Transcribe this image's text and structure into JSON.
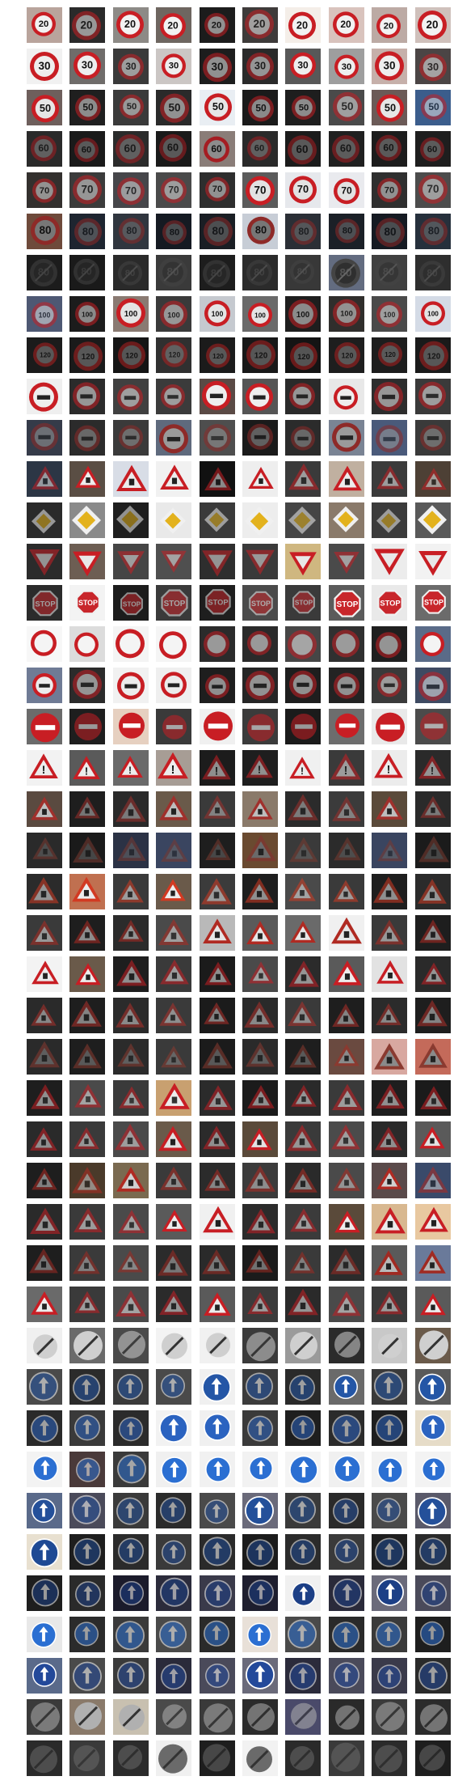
{
  "figure": {
    "description_grid": {
      "rows": 43,
      "cols": 10
    },
    "rows": [
      {
        "sign": "speed-20",
        "text": "20",
        "shape": "circle",
        "rim": "#c81e24",
        "fill": "#f2f2f2",
        "ink": "#111111",
        "bgs": [
          "#b9a49c",
          "#2a2a2a",
          "#8d8a86",
          "#6e6660",
          "#1c1c1c",
          "#3e3b3a",
          "#f4eee8",
          "#d9c3bd",
          "#bcaaa4",
          "#cfc0bb"
        ]
      },
      {
        "sign": "speed-30",
        "text": "30",
        "shape": "circle",
        "rim": "#c81e24",
        "fill": "#eeeeee",
        "ink": "#111111",
        "bgs": [
          "#f1f1f1",
          "#6f6c6a",
          "#3a3a3a",
          "#cbc6c4",
          "#1d1d1d",
          "#2a2a2a",
          "#585858",
          "#9e9e9e",
          "#c6b0aa",
          "#4b4545"
        ]
      },
      {
        "sign": "speed-50",
        "text": "50",
        "shape": "circle",
        "rim": "#c81e24",
        "fill": "#e6e6e6",
        "ink": "#111111",
        "bgs": [
          "#6e5f5c",
          "#1f1f1f",
          "#3a3a3a",
          "#2a2a2a",
          "#e9eef3",
          "#1a1a1a",
          "#1e1e1e",
          "#4a4a4a",
          "#6b5a57",
          "#3b5d8c"
        ]
      },
      {
        "sign": "speed-60",
        "text": "60",
        "shape": "circle",
        "rim": "#a51d22",
        "fill": "#8d8d8d",
        "ink": "#111111",
        "bgs": [
          "#2a2a2a",
          "#1a1a1a",
          "#2b2b2b",
          "#1a1a1a",
          "#8a7d78",
          "#2a2a2a",
          "#1b1b1b",
          "#202020",
          "#1c1c1c",
          "#1e1e1e"
        ]
      },
      {
        "sign": "speed-70",
        "text": "70",
        "shape": "circle",
        "rim": "#c81e24",
        "fill": "#e2e2e2",
        "ink": "#111111",
        "bgs": [
          "#33302e",
          "#3b3b3b",
          "#46464a",
          "#4a4a4a",
          "#2e2e2e",
          "#5b5b5b",
          "#e6e8ec",
          "#e9eaee",
          "#2f2f2f",
          "#4c4c4c"
        ]
      },
      {
        "sign": "speed-80",
        "text": "80",
        "shape": "circle",
        "rim": "#8e2a28",
        "fill": "#777777",
        "ink": "#111111",
        "bgs": [
          "#6e4a3b",
          "#1e2530",
          "#30363f",
          "#151a22",
          "#1a1e24",
          "#c7cdd6",
          "#2b2f36",
          "#1b2027",
          "#151a22",
          "#26303c"
        ]
      },
      {
        "sign": "end-80",
        "text": "80",
        "shape": "circle",
        "rim": "#444444",
        "fill": "#2f2f2f",
        "ink": "#555555",
        "bgs": [
          "#1c1c1c",
          "#1a1a1a",
          "#2a2a2a",
          "#3a3a3a",
          "#1d1d1d",
          "#2b2b2b",
          "#383838",
          "#636c80",
          "#404040",
          "#2e2e2e"
        ]
      },
      {
        "sign": "speed-100",
        "text": "100",
        "shape": "circle",
        "rim": "#c81e24",
        "fill": "#e4e4e4",
        "ink": "#111111",
        "bgs": [
          "#4e5873",
          "#1c1c1c",
          "#8a7a72",
          "#3a3a3a",
          "#c5c9cf",
          "#6a6a6a",
          "#1e1e1e",
          "#302e2c",
          "#4a4a4a",
          "#d4dbe6"
        ]
      },
      {
        "sign": "speed-120",
        "text": "120",
        "shape": "circle",
        "rim": "#b02020",
        "fill": "#8a8a8a",
        "ink": "#111111",
        "bgs": [
          "#1b1b1b",
          "#1a1a1a",
          "#151515",
          "#303030",
          "#1b1b1b",
          "#181818",
          "#141414",
          "#1e1e1e",
          "#1d1d1d",
          "#1a1a1a"
        ]
      },
      {
        "sign": "no-passing",
        "text": "",
        "shape": "circle",
        "rim": "#c81e24",
        "fill": "#eeeeee",
        "ink": "#222222",
        "bgs": [
          "#efefef",
          "#2b2b2b",
          "#404040",
          "#3b3b3b",
          "#5a4a45",
          "#555555",
          "#2a2a2a",
          "#e8e8e8",
          "#2d2d2d",
          "#3a3a3a"
        ]
      },
      {
        "sign": "no-passing-trucks",
        "text": "",
        "shape": "circle",
        "rim": "#8e2a28",
        "fill": "#9a9a9a",
        "ink": "#222222",
        "bgs": [
          "#353b49",
          "#2b2b2b",
          "#3a3a3a",
          "#5f6a7d",
          "#4e4e4e",
          "#1a1a1a",
          "#2b2b2b",
          "#7a8494",
          "#4a5a7a",
          "#3a3a3a"
        ]
      },
      {
        "sign": "right-of-way",
        "text": "",
        "shape": "tri-up",
        "rim": "#c81e24",
        "fill": "#ececec",
        "ink": "#222222",
        "bgs": [
          "#2c3645",
          "#5a4e44",
          "#d8dde6",
          "#f1f1f1",
          "#111111",
          "#eeeeee",
          "#3a3a3a",
          "#c0b0a0",
          "#3b3b3b",
          "#4d4035"
        ]
      },
      {
        "sign": "priority-road",
        "text": "",
        "shape": "diamond",
        "rim": "#f0f0f0",
        "fill": "#e3b21d",
        "ink": "#222222",
        "bgs": [
          "#2a2a2a",
          "#8a8a8a",
          "#1e1e1e",
          "#e9e9e9",
          "#3a3a3a",
          "#ededed",
          "#454545",
          "#8a7a6a",
          "#3b3b3b",
          "#595959"
        ]
      },
      {
        "sign": "yield",
        "text": "",
        "shape": "tri-down",
        "rim": "#c81e24",
        "fill": "#e8e8e8",
        "ink": "#222222",
        "bgs": [
          "#2b2b2b",
          "#6d5e53",
          "#454545",
          "#4f4f4f",
          "#2e2e2e",
          "#3a3a3a",
          "#cfb780",
          "#4a4a4a",
          "#ececec",
          "#f2f2f2"
        ]
      },
      {
        "sign": "stop",
        "text": "STOP",
        "shape": "octagon",
        "rim": "#f0f0f0",
        "fill": "#c8262b",
        "ink": "#ffffff",
        "bgs": [
          "#2b2b2b",
          "#f3f3f3",
          "#1c1c1c",
          "#3a3a3a",
          "#1e1e1e",
          "#4a4a4a",
          "#3a3a3a",
          "#5b5b5b",
          "#e9e9e9",
          "#6b6b6b"
        ]
      },
      {
        "sign": "no-vehicles",
        "text": "",
        "shape": "ring",
        "rim": "#c81e24",
        "fill": "#f4f4f4",
        "ink": "#222222",
        "bgs": [
          "#f7f7f7",
          "#dcdcdc",
          "#f4f4f4",
          "#f5f5f5",
          "#2b2b2b",
          "#2a2a2a",
          "#464646",
          "#303030",
          "#1f1f1f",
          "#5a6b88"
        ]
      },
      {
        "sign": "no-trucks",
        "text": "",
        "shape": "circle",
        "rim": "#c81e24",
        "fill": "#ececec",
        "ink": "#222222",
        "bgs": [
          "#6f7b95",
          "#2b2b2b",
          "#f1f1f1",
          "#efefef",
          "#1e1e1e",
          "#252525",
          "#1e1e1e",
          "#232323",
          "#3a3a3a",
          "#3e4a62"
        ]
      },
      {
        "sign": "no-entry",
        "text": "",
        "shape": "noentry",
        "rim": "#c81e24",
        "fill": "#c81e24",
        "ink": "#ffffff",
        "bgs": [
          "#6b6b6b",
          "#1e1e1e",
          "#e6d0c0",
          "#3a3a3a",
          "#f0f0f0",
          "#3b3b3b",
          "#1b1b1b",
          "#6d6d6d",
          "#e9e9e9",
          "#4b4b4b"
        ]
      },
      {
        "sign": "general-caution",
        "text": "!",
        "shape": "tri-up",
        "rim": "#c81e24",
        "fill": "#ececec",
        "ink": "#111111",
        "bgs": [
          "#f2f2f2",
          "#5a5a5a",
          "#6a6a6a",
          "#a79d95",
          "#1c1c1c",
          "#1e1e1e",
          "#f0f0f0",
          "#3a3a3a",
          "#ececec",
          "#2a2a2a"
        ]
      },
      {
        "sign": "curve-left",
        "text": "",
        "shape": "tri-up",
        "rim": "#a0302c",
        "fill": "#bdbdbd",
        "ink": "#222222",
        "bgs": [
          "#5a4a40",
          "#1e1e1e",
          "#2a2a2a",
          "#6a5a4a",
          "#3a3a3a",
          "#8a7a6a",
          "#2b2b2b",
          "#3b3b3b",
          "#5a4a3a",
          "#2a2a2a"
        ]
      },
      {
        "sign": "curve-right",
        "text": "",
        "shape": "tri-up",
        "rim": "#7a3a30",
        "fill": "#6a6a6a",
        "ink": "#222222",
        "bgs": [
          "#2a2a2a",
          "#1a1a1a",
          "#2b3245",
          "#3a4560",
          "#1e1e1e",
          "#6a4a30",
          "#3a3a3a",
          "#2b2b2b",
          "#3a4560",
          "#1b1b1b"
        ]
      },
      {
        "sign": "double-curve",
        "text": "",
        "shape": "tri-up",
        "rim": "#d23a22",
        "fill": "#ececec",
        "ink": "#222222",
        "bgs": [
          "#2b2b2b",
          "#c07050",
          "#3a3a3a",
          "#6a5a4a",
          "#3b3b3b",
          "#1e1e1e",
          "#4a4a4a",
          "#3a3a3a",
          "#1e1e1e",
          "#2b2b2b"
        ]
      },
      {
        "sign": "bumpy-road",
        "text": "",
        "shape": "tri-up",
        "rim": "#b02a22",
        "fill": "#e6e6e6",
        "ink": "#222222",
        "bgs": [
          "#3a3a3a",
          "#1e1e1e",
          "#2b2b2b",
          "#4a4a4a",
          "#b9b9b9",
          "#5a5a5a",
          "#6a6a6a",
          "#f0f0f0",
          "#3a3a3a",
          "#1e1e1e"
        ]
      },
      {
        "sign": "slippery-road",
        "text": "",
        "shape": "tri-up",
        "rim": "#c81e24",
        "fill": "#ececec",
        "ink": "#222222",
        "bgs": [
          "#f3f3f3",
          "#6a5a4a",
          "#1e1e1e",
          "#3a3a3a",
          "#1b1b1b",
          "#4a4a4a",
          "#2b2b2b",
          "#5a5a5a",
          "#e2e2e2",
          "#2a2a2a"
        ]
      },
      {
        "sign": "road-narrows",
        "text": "",
        "shape": "tri-up",
        "rim": "#b0302a",
        "fill": "#d6d6d6",
        "ink": "#222222",
        "bgs": [
          "#2a2a2a",
          "#1e1e1e",
          "#2b2b2b",
          "#3a3a3a",
          "#1b1b1b",
          "#2a2a2a",
          "#3a3a3a",
          "#1e1e1e",
          "#2b2b2b",
          "#1e1e1e"
        ]
      },
      {
        "sign": "road-work",
        "text": "",
        "shape": "tri-up",
        "rim": "#8a3a30",
        "fill": "#8a8a8a",
        "ink": "#222222",
        "bgs": [
          "#2a2a2a",
          "#1e1e1e",
          "#2b2b2b",
          "#3a3a3a",
          "#1b1b1b",
          "#2a2a2a",
          "#1e1e1e",
          "#6a4a40",
          "#d8a8a0",
          "#c46a5a"
        ]
      },
      {
        "sign": "traffic-signals",
        "text": "",
        "shape": "tri-up",
        "rim": "#c81e24",
        "fill": "#ececec",
        "ink": "#333333",
        "bgs": [
          "#1e1e1e",
          "#4a4a4a",
          "#3a3a3a",
          "#c8a070",
          "#2b2b2b",
          "#1b1b1b",
          "#2a2a2a",
          "#3a3a3a",
          "#1e1e1e",
          "#1b1b1b"
        ]
      },
      {
        "sign": "pedestrians",
        "text": "",
        "shape": "tri-up",
        "rim": "#c81e24",
        "fill": "#e2e2e2",
        "ink": "#222222",
        "bgs": [
          "#2a2a2a",
          "#3a3a3a",
          "#4a4a4a",
          "#6a5a4a",
          "#2b2b2b",
          "#5a4a3a",
          "#3a3a3a",
          "#4b4b4b",
          "#2a2a2a",
          "#5a5a5a"
        ]
      },
      {
        "sign": "children",
        "text": "",
        "shape": "tri-up",
        "rim": "#b02a22",
        "fill": "#d0d0d0",
        "ink": "#222222",
        "bgs": [
          "#1e1e1e",
          "#4a3a2a",
          "#7a6a50",
          "#3a3a3a",
          "#2b2b2b",
          "#3b3b3b",
          "#2a2a2a",
          "#4a4a4a",
          "#5a4a4a",
          "#3a4a6a"
        ]
      },
      {
        "sign": "bicycles",
        "text": "",
        "shape": "tri-up",
        "rim": "#c81e24",
        "fill": "#ececec",
        "ink": "#222222",
        "bgs": [
          "#2a2a2a",
          "#3a3a3a",
          "#4a4a4a",
          "#5a5a5a",
          "#f0f0f0",
          "#2b2b2b",
          "#3b3b3b",
          "#5a4a3a",
          "#d8b890",
          "#e8c8a0"
        ]
      },
      {
        "sign": "ice-snow",
        "text": "",
        "shape": "tri-up",
        "rim": "#a02a22",
        "fill": "#b8b8b8",
        "ink": "#222222",
        "bgs": [
          "#1e1e1e",
          "#3a3a3a",
          "#4a4a4a",
          "#2b2b2b",
          "#2a2a2a",
          "#1b1b1b",
          "#3a3a3a",
          "#2b2b2b",
          "#5a5a5a",
          "#6a7a9a"
        ]
      },
      {
        "sign": "wild-animals",
        "text": "",
        "shape": "tri-up",
        "rim": "#c81e24",
        "fill": "#ececec",
        "ink": "#222222",
        "bgs": [
          "#6a6a6a",
          "#3a3a3a",
          "#4a4a4a",
          "#2b2b2b",
          "#5a5a5a",
          "#3b3b3b",
          "#2a2a2a",
          "#4a4a4a",
          "#3a3a3a",
          "#5a5a5a"
        ]
      },
      {
        "sign": "end-limits",
        "text": "",
        "shape": "end",
        "rim": "#dddddd",
        "fill": "#cfcfcf",
        "ink": "#333333",
        "bgs": [
          "#f0f0f0",
          "#6a6a6a",
          "#4a4a4a",
          "#f3f3f3",
          "#f1f1f1",
          "#3a3a3a",
          "#9a9a9a",
          "#2b2b2b",
          "#c8c8c8",
          "#6a5a4a"
        ]
      },
      {
        "sign": "turn-right",
        "text": "",
        "shape": "blue",
        "rim": "#ffffff",
        "fill": "#2456a6",
        "ink": "#ffffff",
        "bgs": [
          "#4a4a4a",
          "#2b2b2b",
          "#3a3a3a",
          "#4a4a4a",
          "#f0f0f0",
          "#3b3b3b",
          "#2a2a2a",
          "#6a6a6a",
          "#3a3a3a",
          "#5a5a5a"
        ]
      },
      {
        "sign": "turn-left",
        "text": "",
        "shape": "blue",
        "rim": "#ffffff",
        "fill": "#2b63c0",
        "ink": "#ffffff",
        "bgs": [
          "#2a2a2a",
          "#3a3a3a",
          "#2b2b2b",
          "#f2f2f2",
          "#f0f0f0",
          "#3a3a3a",
          "#1e1e1e",
          "#2b2b2b",
          "#1e1e1e",
          "#e6dcc8"
        ]
      },
      {
        "sign": "ahead-only",
        "text": "",
        "shape": "blue",
        "rim": "#ffffff",
        "fill": "#2b6fd2",
        "ink": "#ffffff",
        "bgs": [
          "#f3f3f3",
          "#4a3a3a",
          "#3a3a3a",
          "#f0f0f0",
          "#f1f1f1",
          "#f2f2f2",
          "#f4f4f4",
          "#f0f0f0",
          "#f2f2f2",
          "#f3f3f3"
        ]
      },
      {
        "sign": "straight-right",
        "text": "",
        "shape": "blue",
        "rim": "#ffffff",
        "fill": "#24509a",
        "ink": "#ffffff",
        "bgs": [
          "#5a6a8a",
          "#4a4a5a",
          "#3a3a3a",
          "#2b2b2b",
          "#4a4a4a",
          "#6a6a7a",
          "#3a3a3a",
          "#2a2a2a",
          "#4a4a4a",
          "#5a5a6a"
        ]
      },
      {
        "sign": "straight-left",
        "text": "",
        "shape": "blue",
        "rim": "#ffffff",
        "fill": "#1f4a94",
        "ink": "#ffffff",
        "bgs": [
          "#e8e0d0",
          "#1e1e1e",
          "#2b2b2b",
          "#3a3a3a",
          "#2a2a2a",
          "#1b1b1b",
          "#2b2b2b",
          "#3a3a3a",
          "#1e1e1e",
          "#2a2a2a"
        ]
      },
      {
        "sign": "keep-right",
        "text": "",
        "shape": "blue",
        "rim": "#ffffff",
        "fill": "#1c3f86",
        "ink": "#ffffff",
        "bgs": [
          "#1e1e1e",
          "#2a2a2a",
          "#1b1b2b",
          "#2b2b3b",
          "#3a3a4a",
          "#1e1e2e",
          "#f0f0f0",
          "#2a2a3a",
          "#6a6a7a",
          "#4a4a5a"
        ]
      },
      {
        "sign": "keep-left",
        "text": "",
        "shape": "blue",
        "rim": "#ffffff",
        "fill": "#2b6fd2",
        "ink": "#ffffff",
        "bgs": [
          "#e8e8e8",
          "#2b2b2b",
          "#3a3a3a",
          "#4a4a4a",
          "#2a2a2a",
          "#e8e0d8",
          "#4a4a4a",
          "#2a2a2a",
          "#3a3a3a",
          "#1e1e1e"
        ]
      },
      {
        "sign": "roundabout",
        "text": "",
        "shape": "blue",
        "rim": "#ffffff",
        "fill": "#23499a",
        "ink": "#ffffff",
        "bgs": [
          "#5a6a8a",
          "#4a4a4a",
          "#3a3a3a",
          "#2a2a3a",
          "#4a4a5a",
          "#6a6a7a",
          "#2b2b3b",
          "#4a4a5a",
          "#3a3a4a",
          "#2a2a2a"
        ]
      },
      {
        "sign": "end-no-passing",
        "text": "",
        "shape": "end",
        "rim": "#cccccc",
        "fill": "#b0b0b0",
        "ink": "#333333",
        "bgs": [
          "#3a3a3a",
          "#8a7a6a",
          "#c8c0b0",
          "#4a4a4a",
          "#3a3a3a",
          "#2b2b2b",
          "#4a4a6a",
          "#2a2a2a",
          "#3a3a3a",
          "#2b2b2b"
        ]
      },
      {
        "sign": "end-no-passing-trucks",
        "text": "",
        "shape": "end",
        "rim": "#999999",
        "fill": "#6a6a6a",
        "ink": "#333333",
        "bgs": [
          "#2a2a2a",
          "#3a3a3a",
          "#2b2b2b",
          "#f0f0f0",
          "#1e1e1e",
          "#f2f2f2",
          "#2a2a2a",
          "#3a3a3a",
          "#2b2b2b",
          "#1e1e1e"
        ]
      }
    ]
  }
}
